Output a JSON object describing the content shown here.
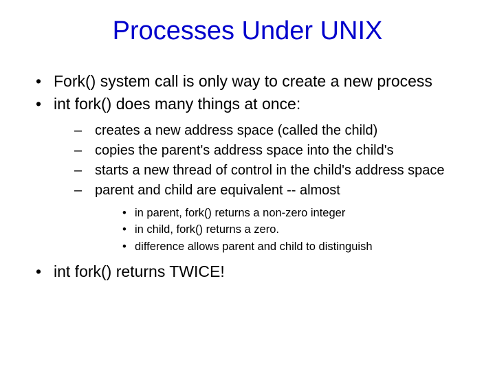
{
  "title": "Processes Under UNIX",
  "bullets_top": [
    "Fork() system call is only way to create a new process",
    "int fork() does many things at once:"
  ],
  "sub_bullets": [
    "creates a new address space (called the child)",
    "copies the parent's address space into the child's",
    "starts a new thread of control in the child's address space",
    "parent and child are equivalent -- almost"
  ],
  "sub_sub_bullets": [
    "in parent, fork() returns a non-zero integer",
    "in child, fork() returns a zero.",
    "difference allows parent and child to distinguish"
  ],
  "final_bullet": "int fork() returns TWICE!"
}
